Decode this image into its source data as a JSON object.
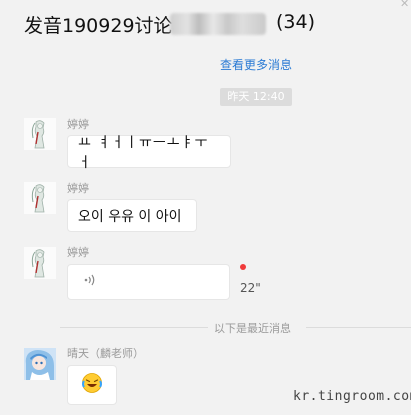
{
  "header": {
    "title": "发音190929讨论",
    "member_count": "(34)"
  },
  "more_messages_link": "查看更多消息",
  "time_separator": "昨天 12:40",
  "messages": [
    {
      "sender": "婷婷",
      "text": "ㅛ ㅕㅓㅣㅠㅡㅗㅑㅜㅓ"
    },
    {
      "sender": "婷婷",
      "text": "오이 우유 이 아이"
    },
    {
      "sender": "婷婷",
      "voice_duration": "22\""
    },
    {
      "sender": "晴天（麟老师）",
      "emoji": "crying-laughing-emoji"
    }
  ],
  "new_messages_divider": "以下是最近消息",
  "watermark": "kr.tingroom.com",
  "colors": {
    "background": "#f2f2f2",
    "link": "#2a7ad4",
    "unread_dot": "#f03a3a"
  }
}
